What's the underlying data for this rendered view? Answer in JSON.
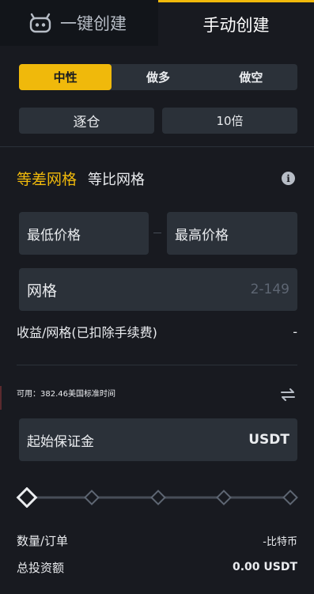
{
  "tabs": {
    "auto_label": "一键创建",
    "manual_label": "手动创建"
  },
  "direction": {
    "options": [
      "中性",
      "做多",
      "做空"
    ],
    "selected": "中性"
  },
  "margin_mode": {
    "mode_label": "逐仓",
    "leverage_label": "10倍"
  },
  "grid_type": {
    "arithmetic_label": "等差网格",
    "geometric_label": "等比网格",
    "selected": "等差网格"
  },
  "price": {
    "low_placeholder": "最低价格",
    "high_placeholder": "最高价格"
  },
  "grid_count": {
    "label": "网格",
    "range_hint": "2-149"
  },
  "profit": {
    "label": "收益/网格(已扣除手续费)",
    "value": "-"
  },
  "available": {
    "text": "可用：382.46美国标准时间"
  },
  "margin": {
    "label": "起始保证金",
    "unit": "USDT"
  },
  "slider": {
    "fraction": 0
  },
  "summary": {
    "qty_label": "数量/订单",
    "qty_value": "-比特币",
    "total_label": "总投资额",
    "total_value": "0.00 USDT"
  },
  "colors": {
    "accent": "#f0b90b",
    "background": "#181a20",
    "panel": "#2b3139"
  },
  "icons": {
    "auto_tab": "robot-icon",
    "info": "info-icon",
    "swap": "swap-icon"
  }
}
